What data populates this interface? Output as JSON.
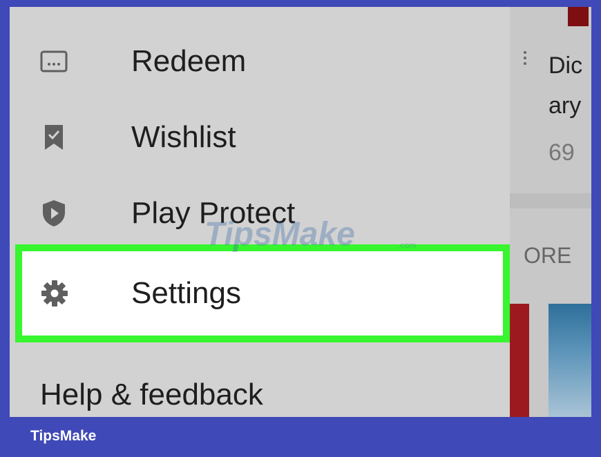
{
  "drawer": {
    "items": [
      {
        "label": "Redeem",
        "icon": "redeem-icon"
      },
      {
        "label": "Wishlist",
        "icon": "wishlist-icon"
      },
      {
        "label": "Play Protect",
        "icon": "play-protect-icon"
      },
      {
        "label": "Settings",
        "icon": "gear-icon",
        "highlighted": true
      }
    ],
    "help": {
      "label": "Help & feedback"
    }
  },
  "background": {
    "peek_lines": [
      "Dic",
      "ary",
      "69"
    ],
    "section_more": "ORE"
  },
  "watermark": {
    "text": "TipsMake",
    "suffix": ".com"
  },
  "footer": {
    "brand": "TipsMake"
  },
  "colors": {
    "frame": "#3f49b7",
    "highlight_border": "#37f52f",
    "drawer_bg": "#d2d2d2",
    "icon_gray": "#5f5f5f"
  }
}
